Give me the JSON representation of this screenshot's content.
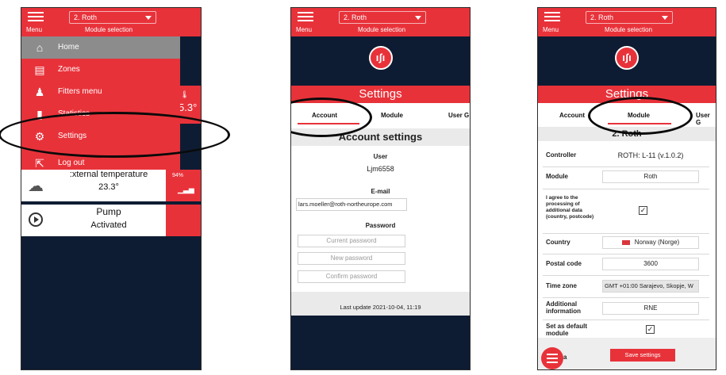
{
  "common": {
    "menu_label": "Menu",
    "module_selected": "2. Roth",
    "module_selection_label": "Module selection",
    "brand_color": "#e8323a",
    "dark_color": "#0e1c33"
  },
  "phone1": {
    "menu_items": [
      {
        "label": "Home",
        "icon": "home-icon",
        "glyph": "⌂"
      },
      {
        "label": "Zones",
        "icon": "zones-icon",
        "glyph": "▤"
      },
      {
        "label": "Fitters menu",
        "icon": "fitters-icon",
        "glyph": "♟"
      },
      {
        "label": "Statistics",
        "icon": "statistics-icon",
        "glyph": "▮"
      },
      {
        "label": "Settings",
        "icon": "settings-icon",
        "glyph": "⚙"
      },
      {
        "label": "Log out",
        "icon": "logout-icon",
        "glyph": "⇱"
      }
    ],
    "side_value": "5.3°",
    "ext_temp_title": ":xternal temperature",
    "ext_temp_value": "23.3°",
    "battery": "94%",
    "pump_title": "Pump",
    "pump_state": "Activated"
  },
  "phone2": {
    "banner": "Settings",
    "tabs": [
      "Account",
      "Module",
      "User G"
    ],
    "section_title": "Account settings",
    "user_label": "User",
    "user_value": "Ljm6558",
    "email_label": "E-mail",
    "email_value": "lars.moeller@roth-northeurope.com",
    "password_label": "Password",
    "placeholders": {
      "current": "Current password",
      "new": "New password",
      "confirm": "Confirm password"
    },
    "last_update": "Last update 2021-10-04, 11:19"
  },
  "phone3": {
    "banner": "Settings",
    "tabs": [
      "Account",
      "Module",
      "User G"
    ],
    "section_title": "2. Roth",
    "rows": {
      "controller_label": "Controller",
      "controller_value": "ROTH: L-11 (v.1.0.2)",
      "module_label": "Module",
      "module_value": "Roth",
      "consent_label": "I agree to the processing of additional data (country, postcode)",
      "consent_checked": true,
      "country_label": "Country",
      "country_value": "Norway (Norge)",
      "postal_label": "Postal code",
      "postal_value": "3600",
      "timezone_label": "Time zone",
      "timezone_value": "GMT +01:00 Sarajevo, Skopje, W",
      "additional_label": "Additional information",
      "additional_value": "RNE",
      "default_label": "Set as default module",
      "default_checked": true
    },
    "save_label": "Save settings"
  }
}
